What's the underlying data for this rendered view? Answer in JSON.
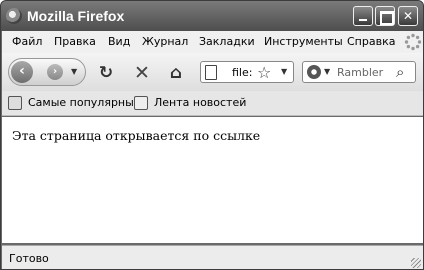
{
  "window": {
    "title": "Mozilla Firefox"
  },
  "menu": [
    "Файл",
    "Правка",
    "Вид",
    "Журнал",
    "Закладки",
    "Инструменты",
    "Справка"
  ],
  "nav": {
    "url": "file:",
    "search_placeholder": "Rambler"
  },
  "bookmarks": [
    "Самые популярные",
    "Лента новостей"
  ],
  "content": {
    "text": "Эта страница открывается по ссылке"
  },
  "status": {
    "text": "Готово"
  }
}
